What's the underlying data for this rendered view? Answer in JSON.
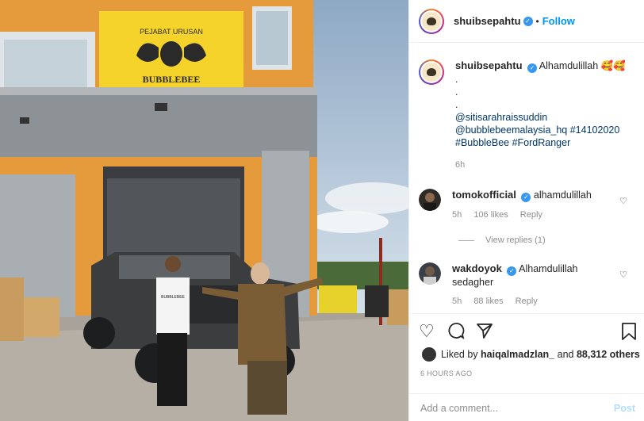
{
  "post": {
    "author": "shuibsepahtu",
    "follow_label": "Follow",
    "separator": "•",
    "caption": "Alhamdulillah 🥰🥰",
    "caption_dots": [
      ".",
      ".",
      "."
    ],
    "mentions": [
      "@sitisarahraissuddin",
      "@bubblebeemalaysia_hq #14102020",
      "#BubbleBee #FordRanger"
    ],
    "caption_age": "6h"
  },
  "photo": {
    "sign_top": "PEJABAT URUSAN",
    "sign_brand": "BUBBLEBEE",
    "shirt_text": "BUBBLEBEE"
  },
  "comments": [
    {
      "user": "tomokofficial",
      "text": "alhamdulillah",
      "age": "5h",
      "likes": "106 likes",
      "reply": "Reply",
      "view_replies": "View replies (1)"
    },
    {
      "user": "wakdoyok",
      "text": "Alhamdulillah",
      "text2": "sedagher",
      "age": "5h",
      "likes": "88 likes",
      "reply": "Reply"
    }
  ],
  "likes": {
    "prefix": "Liked by",
    "user": "haiqalmadzlan_",
    "middle": "and",
    "count": "88,312 others"
  },
  "timestamp": "6 HOURS AGO",
  "composer": {
    "placeholder": "Add a comment...",
    "post_label": "Post"
  },
  "icons": [
    "heart-icon",
    "comment-icon",
    "share-icon",
    "bookmark-icon",
    "verified-icon"
  ],
  "colors": {
    "accent": "#0095f6",
    "verified": "#3897f0",
    "sign_yellow": "#f5d32a",
    "wall_orange": "#e79a3a"
  }
}
